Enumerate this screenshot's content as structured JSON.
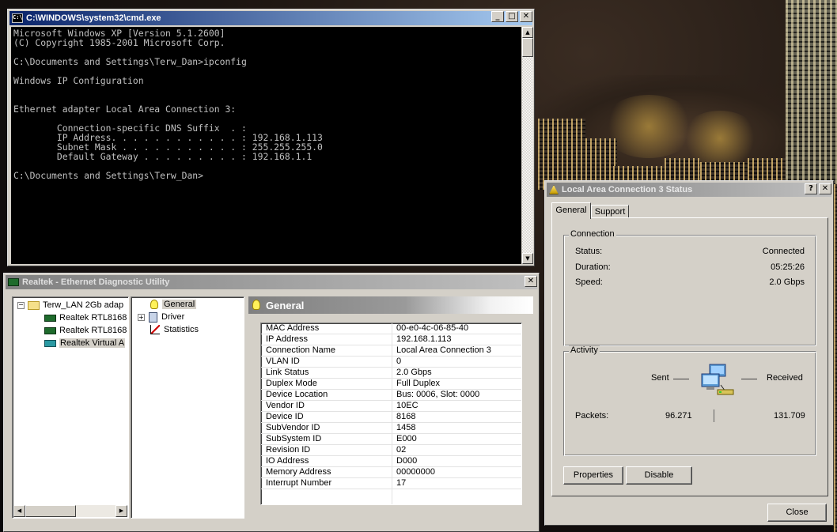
{
  "cmd": {
    "title": "C:\\WINDOWS\\system32\\cmd.exe",
    "lines": [
      "Microsoft Windows XP [Version 5.1.2600]",
      "(C) Copyright 1985-2001 Microsoft Corp.",
      "",
      "C:\\Documents and Settings\\Terw_Dan>ipconfig",
      "",
      "Windows IP Configuration",
      "",
      "",
      "Ethernet adapter Local Area Connection 3:",
      "",
      "        Connection-specific DNS Suffix  . :",
      "        IP Address. . . . . . . . . . . . : 192.168.1.113",
      "        Subnet Mask . . . . . . . . . . . : 255.255.255.0",
      "        Default Gateway . . . . . . . . . : 192.168.1.1",
      "",
      "C:\\Documents and Settings\\Terw_Dan>"
    ]
  },
  "realtek": {
    "title": "Realtek - Ethernet Diagnostic Utility",
    "tree": {
      "root": "Terw_LAN 2Gb adap",
      "children": [
        "Realtek RTL8168",
        "Realtek RTL8168",
        "Realtek Virtual A"
      ]
    },
    "nav": [
      "General",
      "Driver",
      "Statistics"
    ],
    "header": "General",
    "properties": [
      [
        "MAC Address",
        "00-e0-4c-06-85-40"
      ],
      [
        "IP Address",
        "192.168.1.113"
      ],
      [
        "Connection Name",
        "Local Area Connection 3"
      ],
      [
        "VLAN ID",
        "0"
      ],
      [
        "Link Status",
        "2.0 Gbps"
      ],
      [
        "Duplex Mode",
        "Full Duplex"
      ],
      [
        "Device Location",
        "Bus: 0006, Slot: 0000"
      ],
      [
        "Vendor ID",
        "10EC"
      ],
      [
        "Device ID",
        "8168"
      ],
      [
        "SubVendor ID",
        "1458"
      ],
      [
        "SubSystem ID",
        "E000"
      ],
      [
        "Revision ID",
        "02"
      ],
      [
        "IO Address",
        "D000"
      ],
      [
        "Memory Address",
        "00000000"
      ],
      [
        "Interrupt Number",
        "17"
      ]
    ]
  },
  "lan": {
    "title": "Local Area Connection 3 Status",
    "tabs": [
      "General",
      "Support"
    ],
    "connection": {
      "group": "Connection",
      "status_label": "Status:",
      "status": "Connected",
      "duration_label": "Duration:",
      "duration": "05:25:26",
      "speed_label": "Speed:",
      "speed": "2.0 Gbps"
    },
    "activity": {
      "group": "Activity",
      "sent_label": "Sent",
      "received_label": "Received",
      "packets_label": "Packets:",
      "sent": "96.271",
      "received": "131.709"
    },
    "buttons": {
      "properties": "Properties",
      "disable": "Disable",
      "close": "Close"
    }
  },
  "icons": {
    "cmd": "console-icon",
    "network": "network-computers-icon",
    "tray": "network-status-icon",
    "bulb": "lightbulb-icon"
  },
  "colors": {
    "active_title": "#0a246a",
    "console_bg": "#000000",
    "console_fg": "#c0c0c0"
  }
}
